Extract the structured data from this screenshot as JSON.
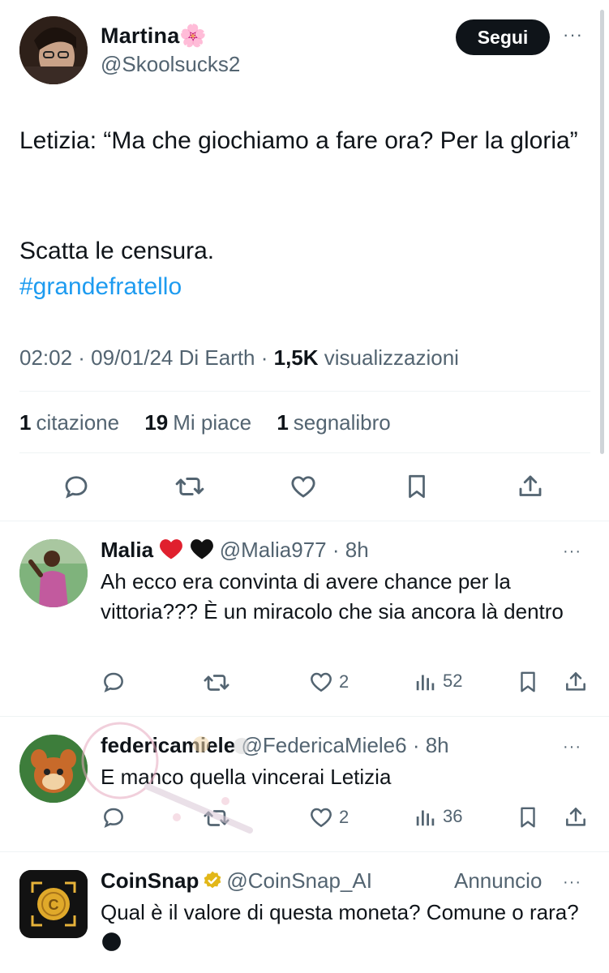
{
  "main_tweet": {
    "author_name": "Martina🌸",
    "author_handle": "@Skoolsucks2",
    "follow_label": "Segui",
    "more_label": "···",
    "text_line1": "Letizia: “Ma che giochiamo a fare ora? Per la gloria”",
    "text_line2": "Scatta le censura.",
    "hashtag": "#grandefratello",
    "meta_time": "02:02 · 09/01/24 Di Earth · ",
    "meta_views_count": "1,5K",
    "meta_views_label": " visualizzazioni",
    "stats": [
      {
        "count": "1",
        "label": "citazione"
      },
      {
        "count": "19",
        "label": "Mi piace"
      },
      {
        "count": "1",
        "label": "segnalibro"
      }
    ],
    "actions": [
      "reply-icon",
      "retweet-icon",
      "like-icon",
      "bookmark-icon",
      "share-icon"
    ]
  },
  "replies": [
    {
      "name": "Malia",
      "handle": "@Malia977 · 8h",
      "more_label": "···",
      "text": "Ah ecco era convinta di avere chance per la vittoria??? È un miracolo che sia ancora là dentro",
      "likes": "2",
      "views": "52"
    },
    {
      "name": "federicamiele",
      "handle": "@FedericaMiele6 · 8h",
      "more_label": "···",
      "text": "E manco quella vincerai Letizia",
      "likes": "2",
      "views": "36"
    }
  ],
  "ad": {
    "name": "CoinSnap",
    "handle": "@CoinSnap_AI",
    "ad_label": "Annuncio",
    "more_label": "···",
    "text": "Qual è il valore di questa moneta? Comune o rara? 🌑"
  },
  "colors": {
    "accent": "#1d9bf0",
    "secondary_text": "#536471",
    "primary_text": "#0f1419",
    "verified_gold": "#e2b719"
  }
}
